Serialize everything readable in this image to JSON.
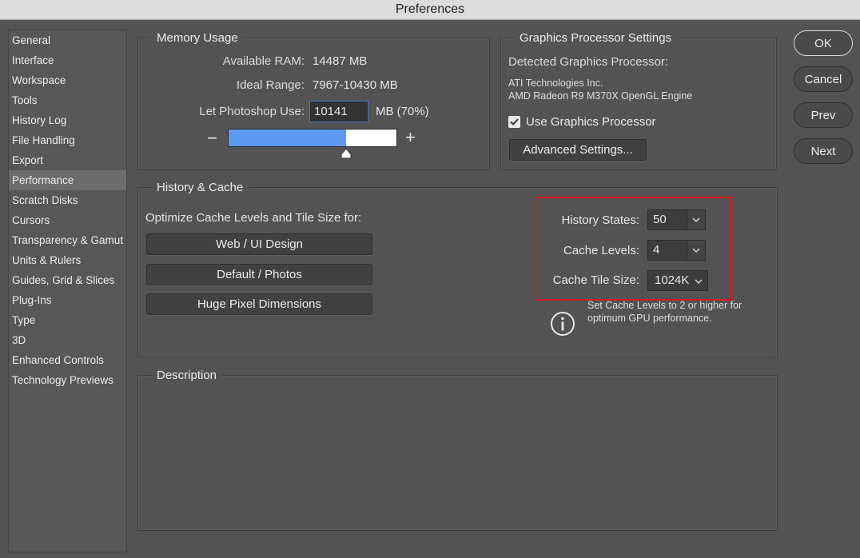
{
  "window": {
    "title": "Preferences"
  },
  "sidebar": {
    "items": [
      {
        "label": "General"
      },
      {
        "label": "Interface"
      },
      {
        "label": "Workspace"
      },
      {
        "label": "Tools"
      },
      {
        "label": "History Log"
      },
      {
        "label": "File Handling"
      },
      {
        "label": "Export"
      },
      {
        "label": "Performance",
        "selected": true
      },
      {
        "label": "Scratch Disks"
      },
      {
        "label": "Cursors"
      },
      {
        "label": "Transparency & Gamut"
      },
      {
        "label": "Units & Rulers"
      },
      {
        "label": "Guides, Grid & Slices"
      },
      {
        "label": "Plug-Ins"
      },
      {
        "label": "Type"
      },
      {
        "label": "3D"
      },
      {
        "label": "Enhanced Controls"
      },
      {
        "label": "Technology Previews"
      }
    ]
  },
  "memory": {
    "title": "Memory Usage",
    "available_label": "Available RAM:",
    "available_value": "14487 MB",
    "ideal_label": "Ideal Range:",
    "ideal_value": "7967-10430 MB",
    "use_label": "Let Photoshop Use:",
    "use_value": "10141",
    "use_suffix": "MB (70%)",
    "minus": "−",
    "plus": "+",
    "slider_fraction": 0.7
  },
  "gpu": {
    "title": "Graphics Processor Settings",
    "detected_label": "Detected Graphics Processor:",
    "vendor": "ATI Technologies Inc.",
    "model": "AMD Radeon R9 M370X OpenGL Engine",
    "use_label": "Use Graphics Processor",
    "use_checked": true,
    "advanced_label": "Advanced Settings..."
  },
  "history": {
    "title": "History & Cache",
    "optimize_label": "Optimize Cache Levels and Tile Size for:",
    "preset_web": "Web / UI Design",
    "preset_default": "Default / Photos",
    "preset_huge": "Huge Pixel Dimensions",
    "states_label": "History States:",
    "states_value": "50",
    "levels_label": "Cache Levels:",
    "levels_value": "4",
    "tile_label": "Cache Tile Size:",
    "tile_value": "1024K",
    "info_line1": "Set Cache Levels to 2 or higher for",
    "info_line2": "optimum GPU performance."
  },
  "description": {
    "title": "Description"
  },
  "buttons": {
    "ok": "OK",
    "cancel": "Cancel",
    "prev": "Prev",
    "next": "Next"
  },
  "colors": {
    "highlight_box": "#e0161b",
    "slider_fill": "#5b9af0",
    "background": "#535353"
  }
}
